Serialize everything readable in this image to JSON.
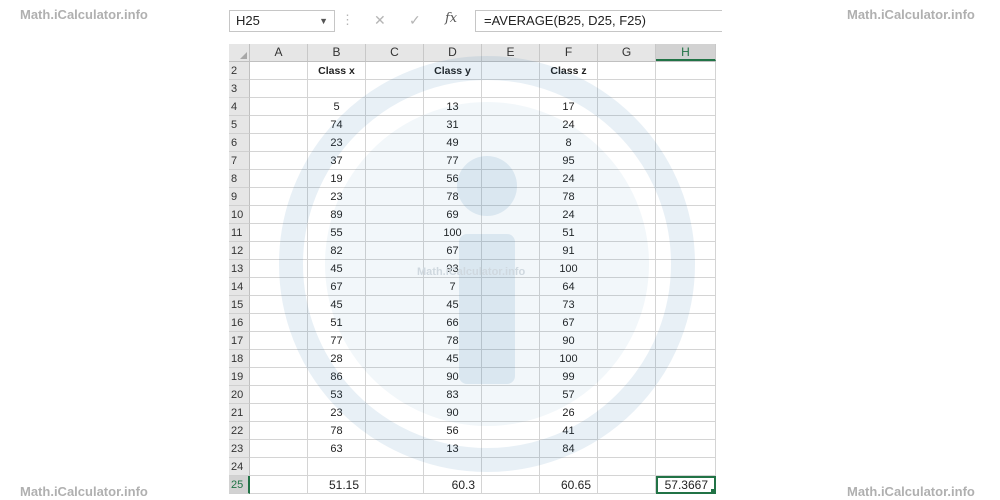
{
  "watermarks": {
    "top_left": "Math.iCalculator.info",
    "top_right": "Math.iCalculator.info",
    "bottom_left": "Math.iCalculator.info",
    "bottom_right": "Math.iCalculator.info",
    "center": "Math.iCalculator.info"
  },
  "formula_bar": {
    "name_box": "H25",
    "formula": "=AVERAGE(B25, D25, F25)",
    "icons": [
      "chevron-down-icon",
      "cancel-icon",
      "enter-check-icon",
      "fx-icon"
    ]
  },
  "columns": [
    "A",
    "B",
    "C",
    "D",
    "E",
    "F",
    "G",
    "H"
  ],
  "selected_column": "H",
  "headers_row": {
    "row": "2",
    "B": "Class x",
    "D": "Class y",
    "F": "Class z"
  },
  "rows": [
    {
      "row": "3",
      "B": "",
      "D": "",
      "F": ""
    },
    {
      "row": "4",
      "B": "5",
      "D": "13",
      "F": "17"
    },
    {
      "row": "5",
      "B": "74",
      "D": "31",
      "F": "24"
    },
    {
      "row": "6",
      "B": "23",
      "D": "49",
      "F": "8"
    },
    {
      "row": "7",
      "B": "37",
      "D": "77",
      "F": "95"
    },
    {
      "row": "8",
      "B": "19",
      "D": "56",
      "F": "24"
    },
    {
      "row": "9",
      "B": "23",
      "D": "78",
      "F": "78"
    },
    {
      "row": "10",
      "B": "89",
      "D": "69",
      "F": "24"
    },
    {
      "row": "11",
      "B": "55",
      "D": "100",
      "F": "51"
    },
    {
      "row": "12",
      "B": "82",
      "D": "67",
      "F": "91"
    },
    {
      "row": "13",
      "B": "45",
      "D": "93",
      "F": "100"
    },
    {
      "row": "14",
      "B": "67",
      "D": "7",
      "F": "64"
    },
    {
      "row": "15",
      "B": "45",
      "D": "45",
      "F": "73"
    },
    {
      "row": "16",
      "B": "51",
      "D": "66",
      "F": "67"
    },
    {
      "row": "17",
      "B": "77",
      "D": "78",
      "F": "90"
    },
    {
      "row": "18",
      "B": "28",
      "D": "45",
      "F": "100"
    },
    {
      "row": "19",
      "B": "86",
      "D": "90",
      "F": "99"
    },
    {
      "row": "20",
      "B": "53",
      "D": "83",
      "F": "57"
    },
    {
      "row": "21",
      "B": "23",
      "D": "90",
      "F": "26"
    },
    {
      "row": "22",
      "B": "78",
      "D": "56",
      "F": "41"
    },
    {
      "row": "23",
      "B": "63",
      "D": "13",
      "F": "84"
    },
    {
      "row": "24",
      "B": "",
      "D": "",
      "F": ""
    }
  ],
  "summary_row": {
    "row": "25",
    "B": "51.15",
    "D": "60.3",
    "F": "60.65",
    "H": "57.3667"
  },
  "colors": {
    "accent": "#217346",
    "watermark": "#1f6fa8"
  }
}
